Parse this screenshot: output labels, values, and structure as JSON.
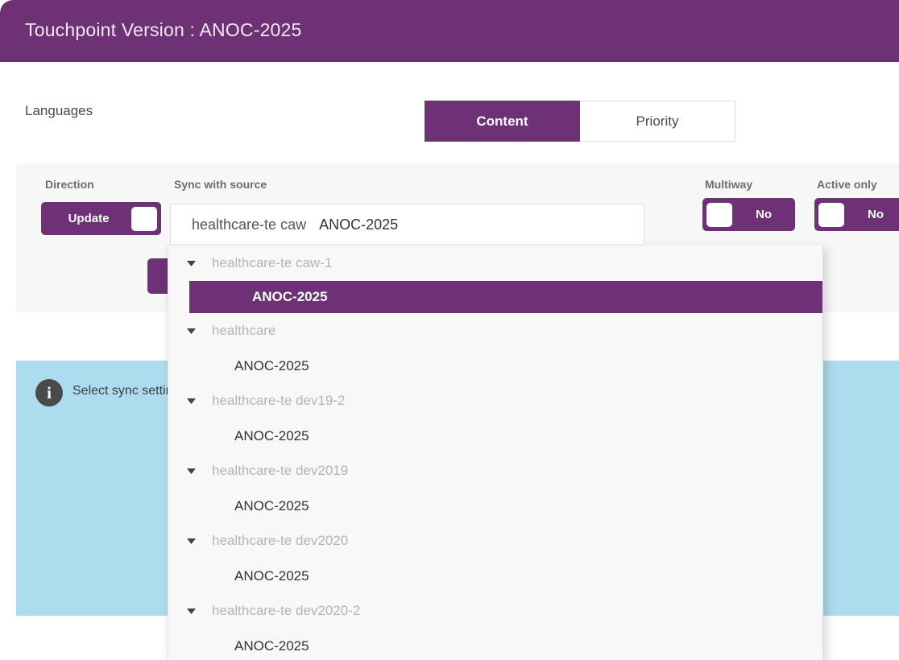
{
  "window": {
    "title": "Touchpoint Version : ANOC-2025"
  },
  "tabs": [
    {
      "label": "Content",
      "active": true
    },
    {
      "label": "Priority",
      "active": false
    }
  ],
  "settings": {
    "direction": {
      "label": "Direction",
      "toggle_value": "Update"
    },
    "sync_with_source": {
      "label": "Sync with source",
      "value_source": "healthcare-te caw",
      "value_version": "ANOC-2025"
    },
    "multiway": {
      "label": "Multiway",
      "toggle_value": "No"
    },
    "active_only": {
      "label": "Active only",
      "toggle_value": "No"
    },
    "languages": {
      "label": "Languages"
    }
  },
  "info_banner": {
    "icon": "info-icon",
    "text": "Select sync setting"
  },
  "dropdown": {
    "groups": [
      {
        "label": "healthcare-te caw-1",
        "items": [
          {
            "label": "ANOC-2025",
            "selected": true
          }
        ]
      },
      {
        "label": "healthcare",
        "items": [
          {
            "label": "ANOC-2025",
            "selected": false
          }
        ]
      },
      {
        "label": "healthcare-te dev19-2",
        "items": [
          {
            "label": "ANOC-2025",
            "selected": false
          }
        ]
      },
      {
        "label": "healthcare-te dev2019",
        "items": [
          {
            "label": "ANOC-2025",
            "selected": false
          }
        ]
      },
      {
        "label": "healthcare-te dev2020",
        "items": [
          {
            "label": "ANOC-2025",
            "selected": false
          }
        ]
      },
      {
        "label": "healthcare-te dev2020-2",
        "items": [
          {
            "label": "ANOC-2025",
            "selected": false
          }
        ]
      }
    ]
  },
  "colors": {
    "brand_purple": "#6e3176",
    "panel_gray": "#f7f7f7",
    "info_blue": "#aedcef"
  }
}
